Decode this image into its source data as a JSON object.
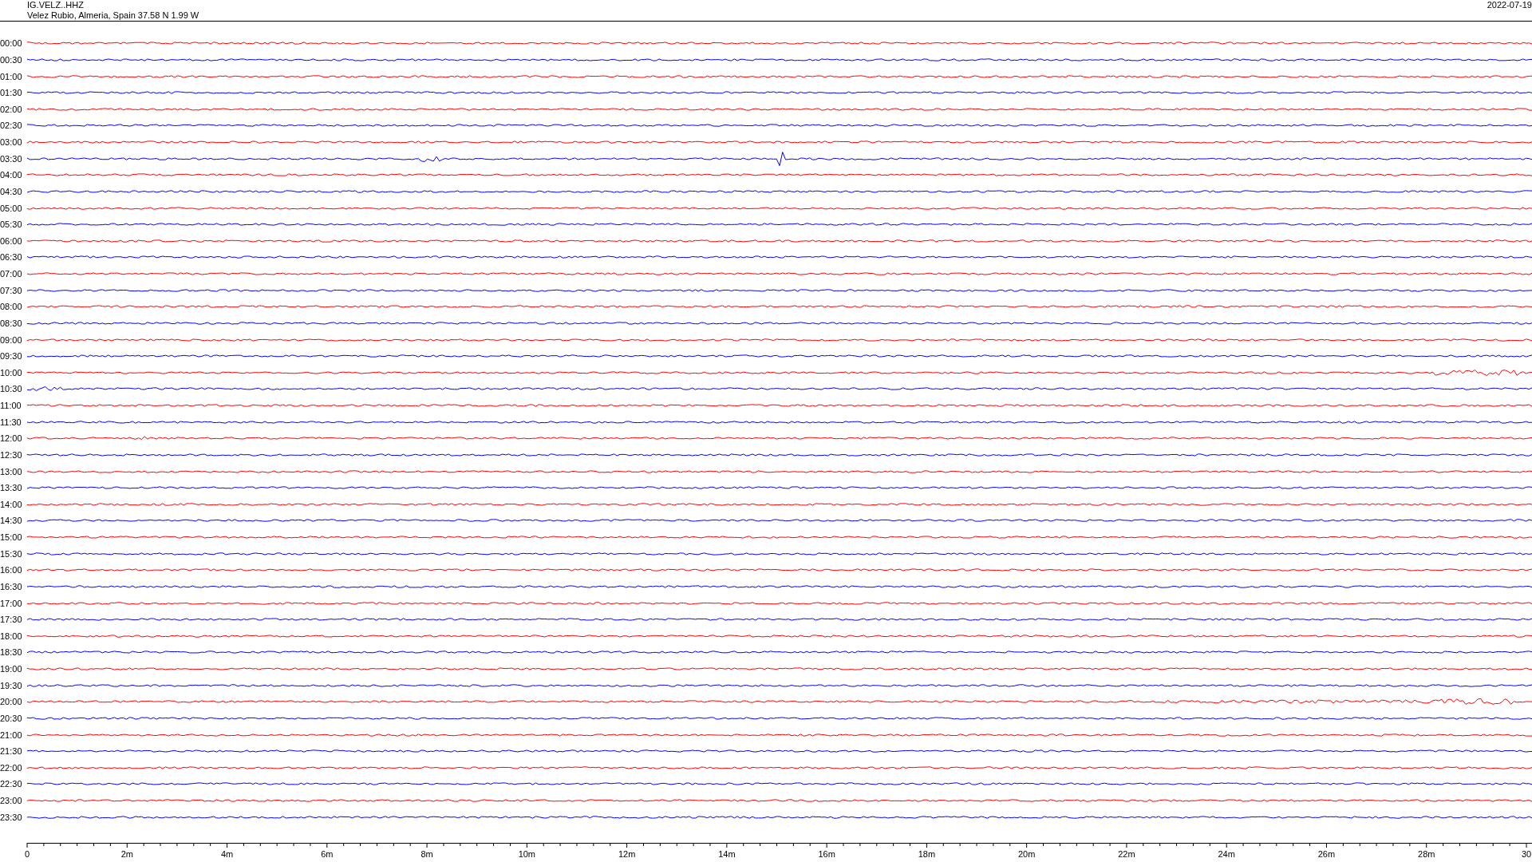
{
  "header": {
    "station": "IG.VELZ..HHZ",
    "location": "Velez Rubio, Almeria, Spain  37.58 N 1.99 W",
    "date": "2022-07-19"
  },
  "rows": [
    {
      "time": "00:00",
      "color": "#ff0000"
    },
    {
      "time": "00:30",
      "color": "#0000ff"
    },
    {
      "time": "01:00",
      "color": "#ff0000"
    },
    {
      "time": "01:30",
      "color": "#0000ff"
    },
    {
      "time": "02:00",
      "color": "#ff0000"
    },
    {
      "time": "02:30",
      "color": "#0000ff"
    },
    {
      "time": "03:00",
      "color": "#ff0000"
    },
    {
      "time": "03:30",
      "color": "#0000ff"
    },
    {
      "time": "04:00",
      "color": "#ff0000"
    },
    {
      "time": "04:30",
      "color": "#0000ff"
    },
    {
      "time": "05:00",
      "color": "#ff0000"
    },
    {
      "time": "05:30",
      "color": "#0000ff"
    },
    {
      "time": "06:00",
      "color": "#ff0000"
    },
    {
      "time": "06:30",
      "color": "#0000ff"
    },
    {
      "time": "07:00",
      "color": "#ff0000"
    },
    {
      "time": "07:30",
      "color": "#0000ff"
    },
    {
      "time": "08:00",
      "color": "#ff0000"
    },
    {
      "time": "08:30",
      "color": "#0000ff"
    },
    {
      "time": "09:00",
      "color": "#ff0000"
    },
    {
      "time": "09:30",
      "color": "#0000ff"
    },
    {
      "time": "10:00",
      "color": "#ff0000"
    },
    {
      "time": "10:30",
      "color": "#0000ff"
    },
    {
      "time": "11:00",
      "color": "#ff0000"
    },
    {
      "time": "11:30",
      "color": "#0000ff"
    },
    {
      "time": "12:00",
      "color": "#ff0000"
    },
    {
      "time": "12:30",
      "color": "#0000ff"
    },
    {
      "time": "13:00",
      "color": "#ff0000"
    },
    {
      "time": "13:30",
      "color": "#0000ff"
    },
    {
      "time": "14:00",
      "color": "#ff0000"
    },
    {
      "time": "14:30",
      "color": "#0000ff"
    },
    {
      "time": "15:00",
      "color": "#ff0000"
    },
    {
      "time": "15:30",
      "color": "#0000ff"
    },
    {
      "time": "16:00",
      "color": "#ff0000"
    },
    {
      "time": "16:30",
      "color": "#0000ff"
    },
    {
      "time": "17:00",
      "color": "#ff0000"
    },
    {
      "time": "17:30",
      "color": "#0000ff"
    },
    {
      "time": "18:00",
      "color": "#ff0000"
    },
    {
      "time": "18:30",
      "color": "#0000ff"
    },
    {
      "time": "19:00",
      "color": "#ff0000"
    },
    {
      "time": "19:30",
      "color": "#0000ff"
    },
    {
      "time": "20:00",
      "color": "#ff0000"
    },
    {
      "time": "20:30",
      "color": "#0000ff"
    },
    {
      "time": "21:00",
      "color": "#ff0000"
    },
    {
      "time": "21:30",
      "color": "#0000ff"
    },
    {
      "time": "22:00",
      "color": "#ff0000"
    },
    {
      "time": "22:30",
      "color": "#0000ff"
    },
    {
      "time": "23:00",
      "color": "#ff0000"
    },
    {
      "time": "23:30",
      "color": "#0000ff"
    }
  ],
  "axis": {
    "ticks": [
      "0",
      "2m",
      "4m",
      "6m",
      "8m",
      "10m",
      "12m",
      "14m",
      "16m",
      "18m",
      "20m",
      "22m",
      "24m",
      "26m",
      "28m",
      "30"
    ]
  }
}
